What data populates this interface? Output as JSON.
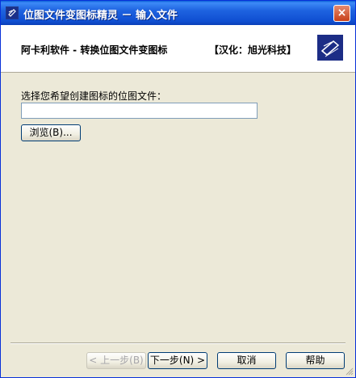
{
  "window": {
    "title": "位图文件变图标精灵 － 输入文件",
    "close_glyph": "×"
  },
  "header": {
    "left_text": "阿卡利软件 - 转换位图文件变图标",
    "right_text": "【汉化：旭光科技】"
  },
  "form": {
    "prompt": "选择您希望创建图标的位图文件：",
    "file_value": "",
    "browse_label": "浏览(B)..."
  },
  "footer": {
    "back_label": "< 上一步(B)",
    "next_label": "下一步(N) >",
    "cancel_label": "取消",
    "help_label": "帮助"
  },
  "icons": {
    "app": "app-wizard-icon",
    "logo": "wizard-logo-icon"
  }
}
